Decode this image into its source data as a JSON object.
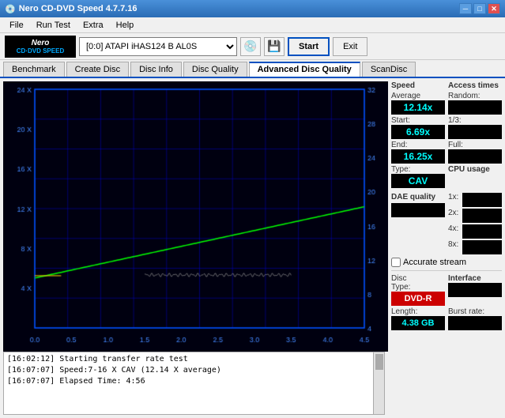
{
  "titlebar": {
    "title": "Nero CD-DVD Speed 4.7.7.16",
    "icon": "disc-icon",
    "controls": [
      "minimize",
      "maximize",
      "close"
    ]
  },
  "menubar": {
    "items": [
      "File",
      "Run Test",
      "Extra",
      "Help"
    ]
  },
  "toolbar": {
    "logo_nero": "Nero",
    "logo_speed": "CD·DVD SPEED",
    "drive_value": "[0:0]  ATAPI iHAS124  B AL0S",
    "start_label": "Start",
    "exit_label": "Exit"
  },
  "tabs": [
    {
      "label": "Benchmark",
      "active": false
    },
    {
      "label": "Create Disc",
      "active": false
    },
    {
      "label": "Disc Info",
      "active": false
    },
    {
      "label": "Disc Quality",
      "active": false
    },
    {
      "label": "Advanced Disc Quality",
      "active": true
    },
    {
      "label": "ScanDisc",
      "active": false
    }
  ],
  "chart": {
    "x_labels": [
      "0.0",
      "0.5",
      "1.0",
      "1.5",
      "2.0",
      "2.5",
      "3.0",
      "3.5",
      "4.0",
      "4.5"
    ],
    "y_left_labels": [
      "4 X",
      "8 X",
      "12 X",
      "16 X",
      "20 X",
      "24 X"
    ],
    "y_right_labels": [
      "4",
      "8",
      "12",
      "16",
      "20",
      "24",
      "28",
      "32"
    ]
  },
  "right_panel": {
    "speed_label": "Speed",
    "average_label": "Average",
    "average_value": "12.14x",
    "start_label": "Start:",
    "start_value": "6.69x",
    "end_label": "End:",
    "end_value": "16.25x",
    "type_label": "Type:",
    "type_value": "CAV",
    "access_times_label": "Access times",
    "random_label": "Random:",
    "random_value": "",
    "onethird_label": "1/3:",
    "onethird_value": "",
    "full_label": "Full:",
    "full_value": "",
    "cpu_label": "CPU usage",
    "cpu_1x_label": "1x:",
    "cpu_1x_value": "",
    "cpu_2x_label": "2x:",
    "cpu_2x_value": "",
    "cpu_4x_label": "4x:",
    "cpu_4x_value": "",
    "cpu_8x_label": "8x:",
    "cpu_8x_value": "",
    "dae_label": "DAE quality",
    "dae_value": "",
    "accurate_label": "Accurate",
    "stream_label": "stream",
    "disc_type_label": "Disc",
    "disc_type_label2": "Type:",
    "disc_type_value": "DVD-R",
    "length_label": "Length:",
    "length_value": "4.38 GB",
    "interface_label": "Interface",
    "burst_label": "Burst rate:"
  },
  "log": {
    "lines": [
      "[16:02:12]  Starting transfer rate test",
      "[16:07:07]  Speed:7-16 X CAV (12.14 X average)",
      "[16:07:07]  Elapsed Time: 4:56"
    ]
  }
}
